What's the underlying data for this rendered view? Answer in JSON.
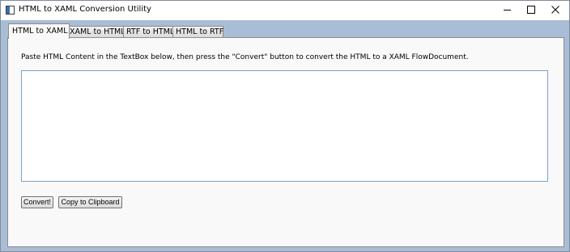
{
  "window": {
    "title": "HTML to XAML Conversion Utility",
    "icon": "app-window-icon"
  },
  "caption_buttons": {
    "minimize_icon": "minimize-icon",
    "maximize_icon": "maximize-icon",
    "close_icon": "close-icon"
  },
  "tabs": [
    {
      "label": "HTML to XAML",
      "selected": true
    },
    {
      "label": "XAML to HTML",
      "selected": false
    },
    {
      "label": "RTF to HTML",
      "selected": false
    },
    {
      "label": "HTML to RTF",
      "selected": false
    }
  ],
  "main": {
    "instructions": "Paste HTML Content in the TextBox below, then press the \"Convert\" button to convert the HTML to a XAML FlowDocument.",
    "input_value": "",
    "convert_label": "Convert!",
    "copy_label": "Copy to Clipboard"
  },
  "colors": {
    "client_background": "#a9bdd6",
    "panel_background": "#f9f9f9",
    "textbox_border": "#7aa3cc"
  }
}
